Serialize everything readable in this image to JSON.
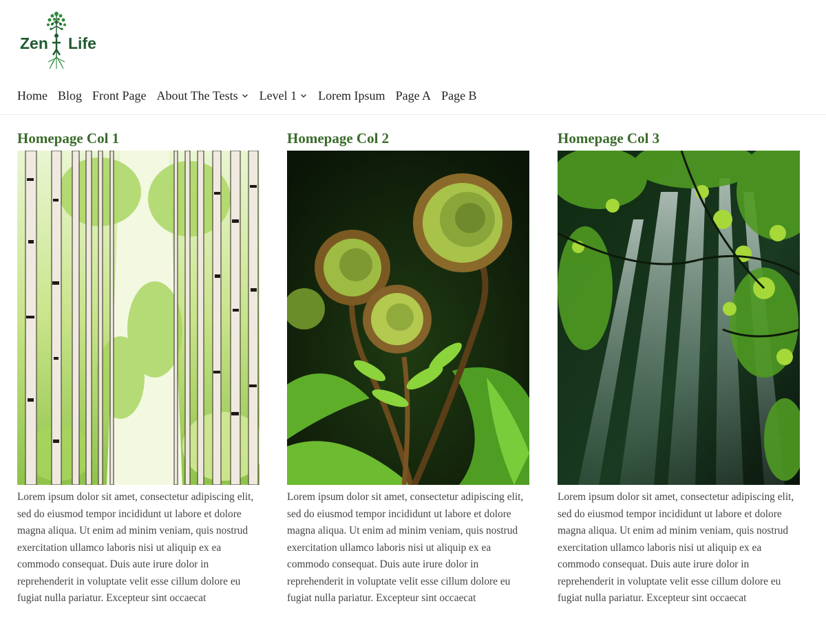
{
  "site": {
    "logo": {
      "word_left": "Zen",
      "word_right": "Life",
      "icon": "tree-figure-icon"
    }
  },
  "nav": {
    "items": [
      {
        "label": "Home",
        "has_dropdown": false
      },
      {
        "label": "Blog",
        "has_dropdown": false
      },
      {
        "label": "Front Page",
        "has_dropdown": false
      },
      {
        "label": "About The Tests",
        "has_dropdown": true
      },
      {
        "label": "Level 1",
        "has_dropdown": true
      },
      {
        "label": "Lorem Ipsum",
        "has_dropdown": false
      },
      {
        "label": "Page A",
        "has_dropdown": false
      },
      {
        "label": "Page B",
        "has_dropdown": false
      }
    ]
  },
  "columns": [
    {
      "title": "Homepage Col 1",
      "image": "birch-forest-photo",
      "text": "Lorem ipsum dolor sit amet, consectetur adipiscing elit, sed do eiusmod tempor incididunt ut labore et dolore magna aliqua. Ut enim ad minim veniam, quis nostrud exercitation ullamco laboris nisi ut aliquip ex ea commodo consequat. Duis aute irure dolor in reprehenderit in voluptate velit esse cillum dolore eu fugiat nulla pariatur. Excepteur sint occaecat"
    },
    {
      "title": "Homepage Col 2",
      "image": "fern-fiddlehead-photo",
      "text": "Lorem ipsum dolor sit amet, consectetur adipiscing elit, sed do eiusmod tempor incididunt ut labore et dolore magna aliqua. Ut enim ad minim veniam, quis nostrud exercitation ullamco laboris nisi ut aliquip ex ea commodo consequat. Duis aute irure dolor in reprehenderit in voluptate velit esse cillum dolore eu fugiat nulla pariatur. Excepteur sint occaecat"
    },
    {
      "title": "Homepage Col 3",
      "image": "sunbeam-forest-photo",
      "text": "Lorem ipsum dolor sit amet, consectetur adipiscing elit, sed do eiusmod tempor incididunt ut labore et dolore magna aliqua. Ut enim ad minim veniam, quis nostrud exercitation ullamco laboris nisi ut aliquip ex ea commodo consequat. Duis aute irure dolor in reprehenderit in voluptate velit esse cillum dolore eu fugiat nulla pariatur. Excepteur sint occaecat"
    }
  ],
  "colors": {
    "heading_green": "#3a6b2a",
    "logo_green": "#1f5a2e",
    "body_text": "#444444"
  }
}
